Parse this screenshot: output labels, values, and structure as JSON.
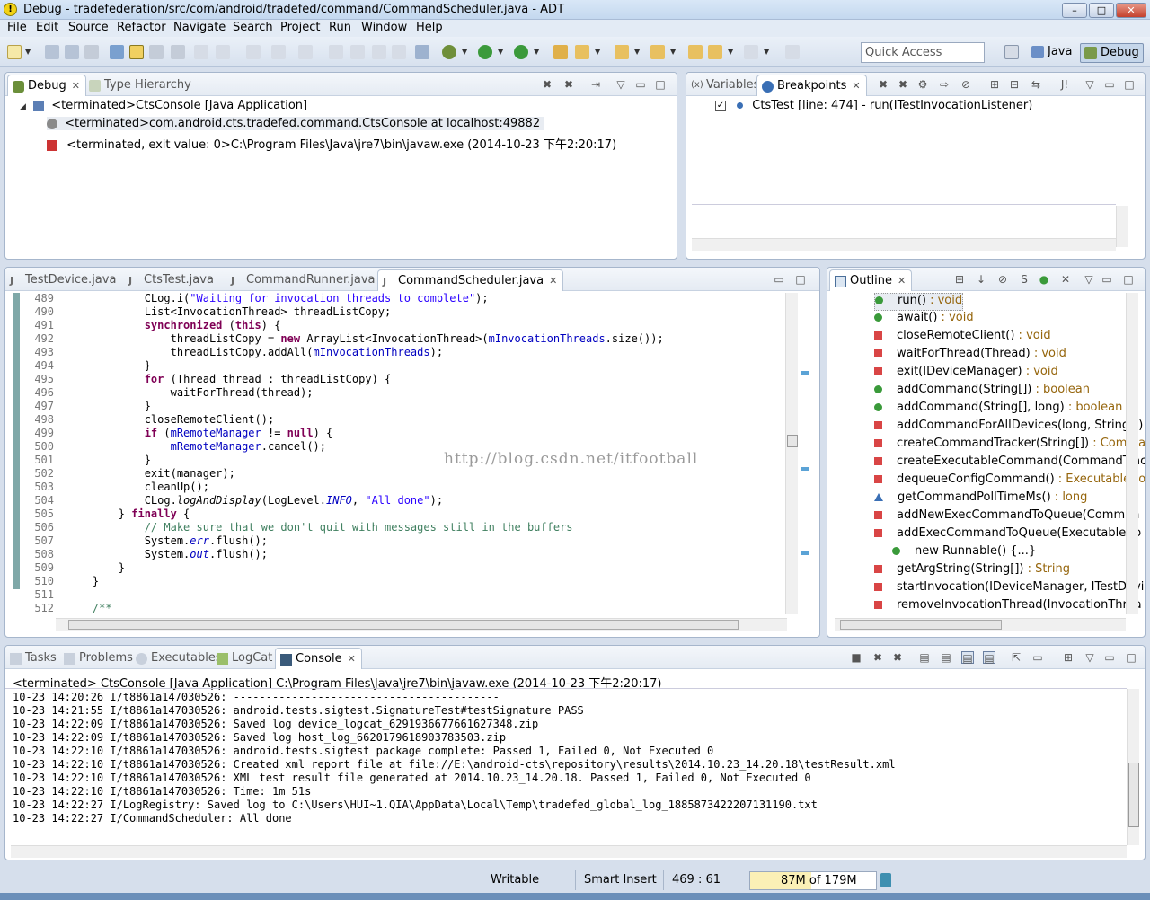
{
  "window": {
    "title": "Debug - tradefederation/src/com/android/tradefed/command/CommandScheduler.java - ADT",
    "min": "–",
    "max": "□",
    "close": "✕"
  },
  "menu": [
    "File",
    "Edit",
    "Source",
    "Refactor",
    "Navigate",
    "Search",
    "Project",
    "Run",
    "Window",
    "Help"
  ],
  "quick_access": {
    "placeholder": "Quick Access"
  },
  "perspectives": {
    "java": "Java",
    "debug": "Debug"
  },
  "debug_panel": {
    "tabs": [
      "Debug",
      "Type Hierarchy"
    ],
    "tree": [
      "<terminated>CtsConsole [Java Application]",
      "<terminated>com.android.cts.tradefed.command.CtsConsole at localhost:49882",
      "<terminated, exit value: 0>C:\\Program Files\\Java\\jre7\\bin\\javaw.exe (2014-10-23 下午2:20:17)"
    ]
  },
  "bp_panel": {
    "tabs": [
      "Variables",
      "Breakpoints"
    ],
    "items": [
      "CtsTest [line: 474] - run(ITestInvocationListener)"
    ]
  },
  "editor": {
    "tabs": [
      "TestDevice.java",
      "CtsTest.java",
      "CommandRunner.java",
      "CommandScheduler.java"
    ],
    "watermark": "http://blog.csdn.net/itfootball",
    "lines": [
      {
        "n": "489",
        "html": "            CLog.i(<span class=\"str\">\"Waiting for invocation threads to complete\"</span>);"
      },
      {
        "n": "490",
        "html": "            List&lt;InvocationThread&gt; threadListCopy;"
      },
      {
        "n": "491",
        "html": "            <span class=\"kw\">synchronized</span> (<span class=\"kw\">this</span>) {"
      },
      {
        "n": "492",
        "html": "                threadListCopy = <span class=\"kw\">new</span> ArrayList&lt;InvocationThread&gt;(<span class=\"fld\">mInvocationThreads</span>.size());"
      },
      {
        "n": "493",
        "html": "                threadListCopy.addAll(<span class=\"fld\">mInvocationThreads</span>);"
      },
      {
        "n": "494",
        "html": "            }"
      },
      {
        "n": "495",
        "html": "            <span class=\"kw\">for</span> (Thread thread : threadListCopy) {"
      },
      {
        "n": "496",
        "html": "                waitForThread(thread);"
      },
      {
        "n": "497",
        "html": "            }"
      },
      {
        "n": "498",
        "html": "            closeRemoteClient();"
      },
      {
        "n": "499",
        "html": "            <span class=\"kw\">if</span> (<span class=\"fld\">mRemoteManager</span> != <span class=\"kw\">null</span>) {"
      },
      {
        "n": "500",
        "html": "                <span class=\"fld\">mRemoteManager</span>.cancel();"
      },
      {
        "n": "501",
        "html": "            }"
      },
      {
        "n": "502",
        "html": "            exit(manager);"
      },
      {
        "n": "503",
        "html": "            cleanUp();"
      },
      {
        "n": "504",
        "html": "            CLog.<span class=\"mth\">logAndDisplay</span>(LogLevel.<span class=\"st\">INFO</span>, <span class=\"str\">\"All done\"</span>);"
      },
      {
        "n": "505",
        "html": "        } <span class=\"kw\">finally</span> {"
      },
      {
        "n": "506",
        "html": "            <span class=\"cm\">// Make sure that we don't quit with messages still in the buffers</span>"
      },
      {
        "n": "507",
        "html": "            System.<span class=\"st\">err</span>.flush();"
      },
      {
        "n": "508",
        "html": "            System.<span class=\"st\">out</span>.flush();"
      },
      {
        "n": "509",
        "html": "        }"
      },
      {
        "n": "510",
        "html": "    }"
      },
      {
        "n": "511",
        "html": ""
      },
      {
        "n": "512",
        "html": "    <span class=\"cm\">/**</span>"
      }
    ]
  },
  "outline": {
    "tab": "Outline",
    "items": [
      {
        "name": "run()",
        "ret": " : void",
        "ic": "green"
      },
      {
        "name": "await()",
        "ret": " : void",
        "ic": "green"
      },
      {
        "name": "closeRemoteClient()",
        "ret": " : void",
        "ic": "red"
      },
      {
        "name": "waitForThread(Thread)",
        "ret": " : void",
        "ic": "red"
      },
      {
        "name": "exit(IDeviceManager)",
        "ret": " : void",
        "ic": "red"
      },
      {
        "name": "addCommand(String[])",
        "ret": " : boolean",
        "ic": "green"
      },
      {
        "name": "addCommand(String[], long)",
        "ret": " : boolean",
        "ic": "green"
      },
      {
        "name": "addCommandForAllDevices(long, String[])",
        "ret": "",
        "ic": "red"
      },
      {
        "name": "createCommandTracker(String[])",
        "ret": " : Comma",
        "ic": "red"
      },
      {
        "name": "createExecutableCommand(CommandTrac",
        "ret": "",
        "ic": "red"
      },
      {
        "name": "dequeueConfigCommand()",
        "ret": " : ExecutableCo",
        "ic": "red"
      },
      {
        "name": "getCommandPollTimeMs()",
        "ret": " : long",
        "ic": "blue"
      },
      {
        "name": "addNewExecCommandToQueue(Comman",
        "ret": "",
        "ic": "red"
      },
      {
        "name": "addExecCommandToQueue(ExecutableCo",
        "ret": "",
        "ic": "red"
      },
      {
        "name": "new Runnable() {...}",
        "ret": "",
        "ic": "run"
      },
      {
        "name": "getArgString(String[])",
        "ret": " : String",
        "ic": "red"
      },
      {
        "name": "startInvocation(IDeviceManager, ITestDevi",
        "ret": "",
        "ic": "red"
      },
      {
        "name": "removeInvocationThread(InvocationThrea",
        "ret": "",
        "ic": "red"
      }
    ]
  },
  "console": {
    "tabs": [
      "Tasks",
      "Problems",
      "Executables",
      "LogCat",
      "Console"
    ],
    "header": "<terminated> CtsConsole [Java Application] C:\\Program Files\\Java\\jre7\\bin\\javaw.exe (2014-10-23 下午2:20:17)",
    "lines": [
      "10-23 14:20:26 I/t8861a147030526: -----------------------------------------",
      "10-23 14:21:55 I/t8861a147030526: android.tests.sigtest.SignatureTest#testSignature PASS",
      "10-23 14:22:09 I/t8861a147030526: Saved log device_logcat_6291936677661627348.zip",
      "10-23 14:22:09 I/t8861a147030526: Saved log host_log_6620179618903783503.zip",
      "10-23 14:22:10 I/t8861a147030526: android.tests.sigtest package complete: Passed 1, Failed 0, Not Executed 0",
      "10-23 14:22:10 I/t8861a147030526: Created xml report file at file://E:\\android-cts\\repository\\results\\2014.10.23_14.20.18\\testResult.xml",
      "10-23 14:22:10 I/t8861a147030526: XML test result file generated at 2014.10.23_14.20.18. Passed 1, Failed 0, Not Executed 0",
      "10-23 14:22:10 I/t8861a147030526: Time: 1m 51s",
      "10-23 14:22:27 I/LogRegistry: Saved log to C:\\Users\\HUI~1.QIA\\AppData\\Local\\Temp\\tradefed_global_log_1885873422207131190.txt",
      "10-23 14:22:27 I/CommandScheduler: All done"
    ]
  },
  "status": {
    "writable": "Writable",
    "insert": "Smart Insert",
    "position": "469 : 61",
    "memory": "87M of 179M",
    "heap_used_fraction": 0.486
  }
}
